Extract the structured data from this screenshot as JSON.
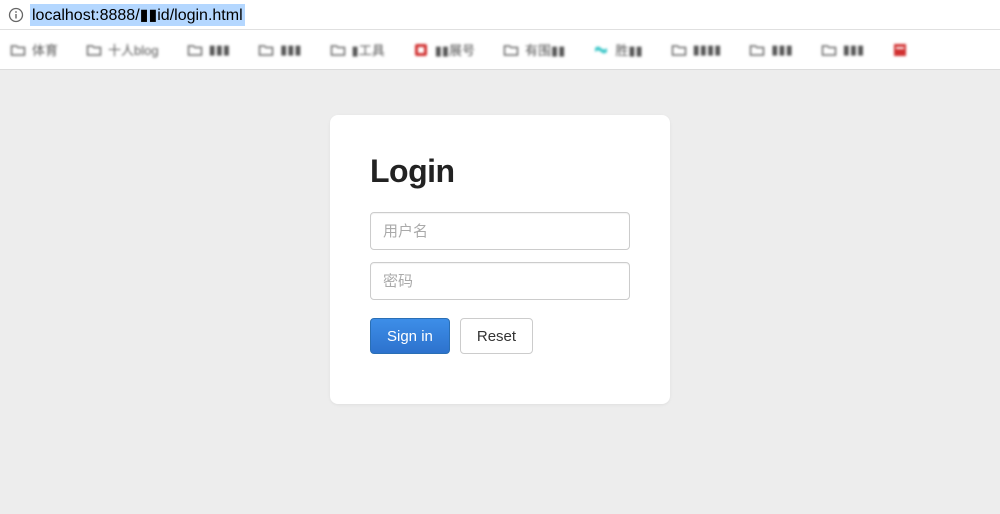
{
  "address_bar": {
    "url": "localhost:8888/▮▮id/login.html"
  },
  "bookmarks": [
    {
      "icon": "folder",
      "label": "体育"
    },
    {
      "icon": "folder",
      "label": "十人blog"
    },
    {
      "icon": "folder",
      "label": "▮▮▮"
    },
    {
      "icon": "folder",
      "label": "▮▮▮"
    },
    {
      "icon": "folder",
      "label": "▮工具"
    },
    {
      "icon": "red",
      "label": "▮▮展号"
    },
    {
      "icon": "folder",
      "label": "有围▮▮"
    },
    {
      "icon": "teal",
      "label": "胜▮▮"
    },
    {
      "icon": "folder",
      "label": "▮▮▮▮"
    },
    {
      "icon": "folder",
      "label": "▮▮▮"
    },
    {
      "icon": "folder",
      "label": "▮▮▮"
    },
    {
      "icon": "redsq",
      "label": ""
    }
  ],
  "login": {
    "title": "Login",
    "username_placeholder": "用户名",
    "password_placeholder": "密码",
    "signin_label": "Sign in",
    "reset_label": "Reset"
  }
}
